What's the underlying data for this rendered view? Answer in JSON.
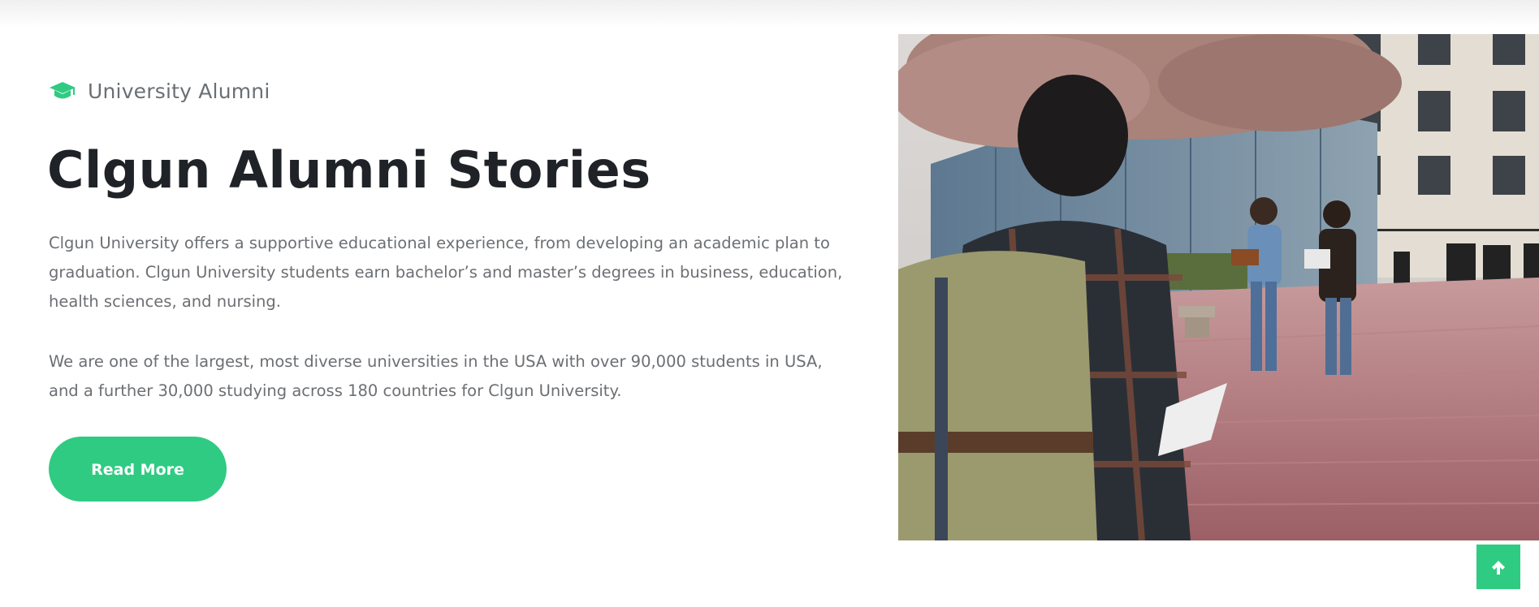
{
  "header": {
    "kicker_icon": "graduation-cap-icon",
    "kicker_text": "University Alumni"
  },
  "main": {
    "title": "Clgun Alumni Stories",
    "paragraph_1": "Clgun University offers a supportive educational experience, from developing an academic plan to graduation. Clgun University students earn bachelor’s and master’s degrees in business, education, health sciences, and nursing.",
    "paragraph_2": "We are one of the largest, most diverse universities in the USA with over 90,000 students in USA, and a further 30,000 studying across 180 countries for Clgun University.",
    "read_more_label": "Read More"
  },
  "photo": {
    "subject": "students walking on university campus"
  },
  "back_to_top": {
    "icon": "arrow-up-icon"
  },
  "colors": {
    "accent": "#2fcb82",
    "heading": "#1f2227",
    "body_text": "#6c6f73"
  }
}
